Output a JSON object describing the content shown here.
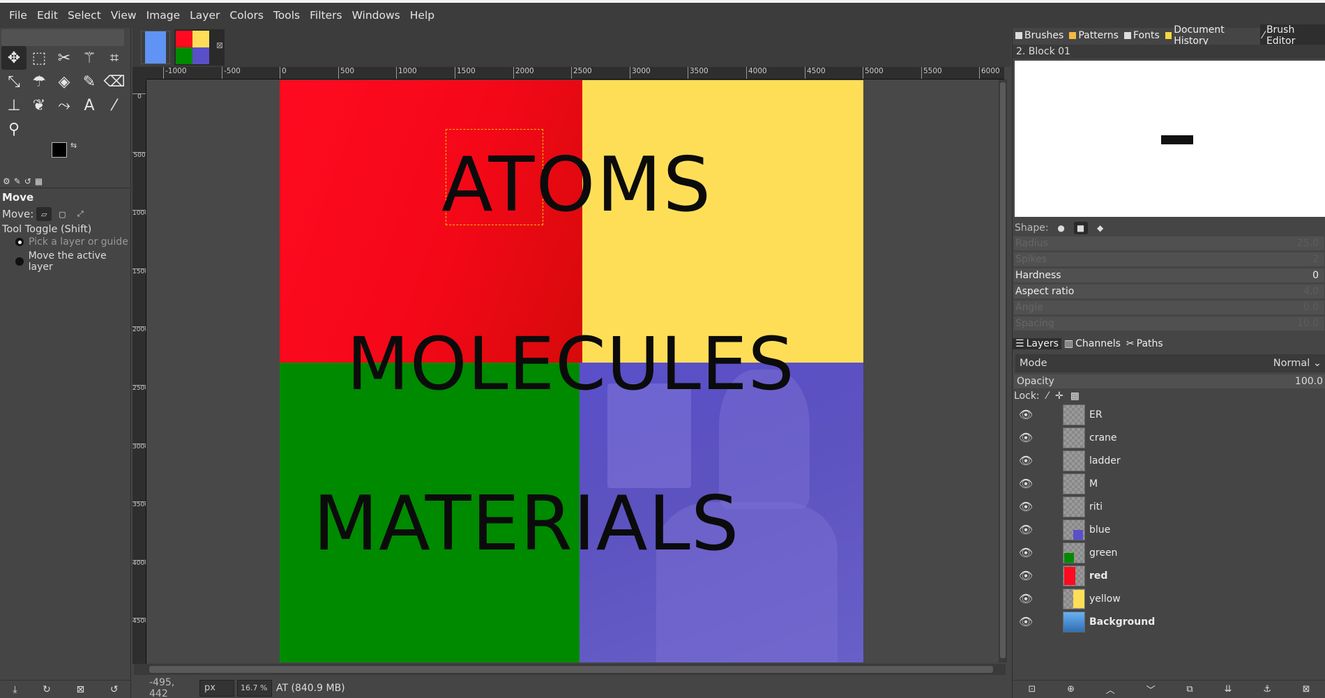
{
  "menu": [
    "File",
    "Edit",
    "Select",
    "View",
    "Image",
    "Layer",
    "Colors",
    "Tools",
    "Filters",
    "Windows",
    "Help"
  ],
  "toolbox": {
    "tool_options_title": "Move",
    "move_label": "Move:",
    "tool_toggle": "Tool Toggle  (Shift)",
    "radio_pick": "Pick a layer or guide",
    "radio_active": "Move the active layer"
  },
  "canvas": {
    "word1": "ATOMS",
    "word2": "MOLECULES",
    "word3": "MATERIALS",
    "colors": {
      "red": "#ff0a21",
      "yellow": "#ffde57",
      "green": "#008a00",
      "blue": "#5a4fc9"
    }
  },
  "ruler_ticks": [
    "-1000",
    "-500",
    "0",
    "500",
    "1000",
    "1500",
    "2000",
    "2500",
    "3000",
    "3500",
    "4000",
    "4500",
    "5000",
    "5500",
    "6000"
  ],
  "status": {
    "coords": "-495, 442",
    "unit": "px",
    "zoom": "16.7 %",
    "message": "AT (840.9 MB)"
  },
  "dock": {
    "tabs": [
      "Brushes",
      "Patterns",
      "Fonts",
      "Document History",
      "Brush Editor"
    ],
    "brush_name": "2. Block 01",
    "shape_label": "Shape:",
    "params": [
      {
        "label": "Radius",
        "value": "25.0"
      },
      {
        "label": "Spikes",
        "value": "2"
      },
      {
        "label": "Hardness",
        "value": "0"
      },
      {
        "label": "Aspect ratio",
        "value": "4.0"
      },
      {
        "label": "Angle",
        "value": "0.0"
      },
      {
        "label": "Spacing",
        "value": "10.0"
      }
    ],
    "layer_tabs": [
      "Layers",
      "Channels",
      "Paths"
    ],
    "mode_label": "Mode",
    "mode_value": "Normal",
    "opacity_label": "Opacity",
    "opacity_value": "100.0",
    "lock_label": "Lock:",
    "layers": [
      {
        "name": "ER",
        "bold": false,
        "thumb": ""
      },
      {
        "name": "crane",
        "bold": false,
        "thumb": ""
      },
      {
        "name": "ladder",
        "bold": false,
        "thumb": ""
      },
      {
        "name": "M",
        "bold": false,
        "thumb": ""
      },
      {
        "name": "riti",
        "bold": false,
        "thumb": ""
      },
      {
        "name": "blue",
        "bold": false,
        "thumb": "#5a4fc9"
      },
      {
        "name": "green",
        "bold": false,
        "thumb": "#008a00"
      },
      {
        "name": "red",
        "bold": true,
        "thumb": "#ff0a21"
      },
      {
        "name": "yellow",
        "bold": false,
        "thumb": "#ffde57"
      },
      {
        "name": "Background",
        "bold": true,
        "thumb": "#2f6fb3"
      }
    ]
  }
}
